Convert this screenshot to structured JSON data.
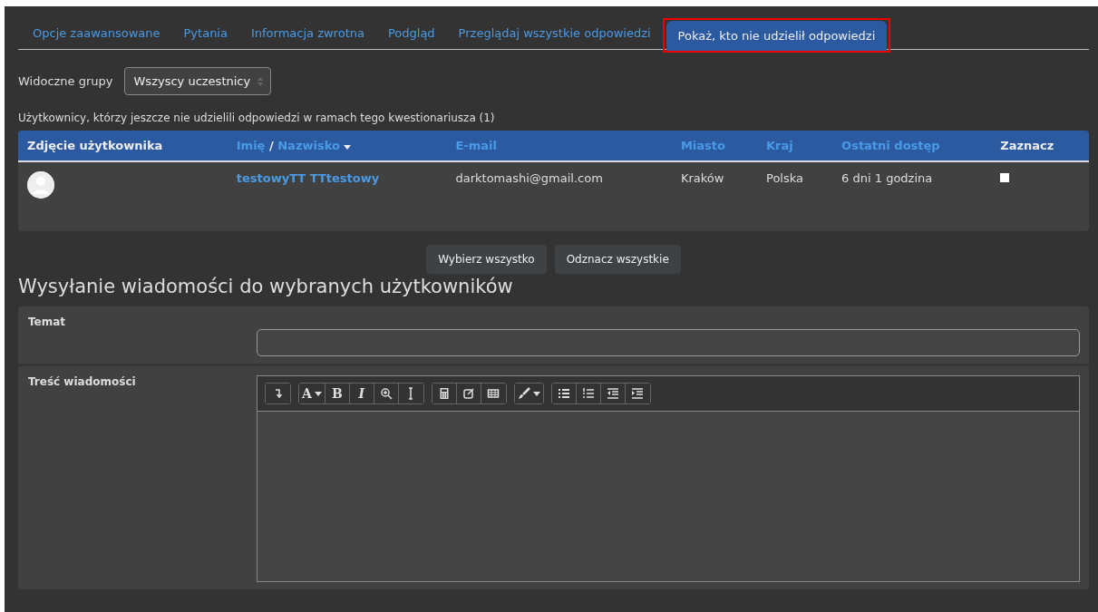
{
  "tabs": [
    {
      "label": "Opcje zaawansowane",
      "selected": false
    },
    {
      "label": "Pytania",
      "selected": false
    },
    {
      "label": "Informacja zwrotna",
      "selected": false
    },
    {
      "label": "Podgląd",
      "selected": false
    },
    {
      "label": "Przeglądaj wszystkie odpowiedzi",
      "selected": false
    },
    {
      "label": "Pokaż, kto nie udzielił odpowiedzi",
      "selected": true,
      "highlighted": true
    }
  ],
  "group_filter": {
    "label": "Widoczne grupy",
    "value": "Wszyscy uczestnicy"
  },
  "caption": "Użytkownicy, którzy jeszcze nie udzielili odpowiedzi w ramach tego kwestionariusza (1)",
  "table": {
    "columns": [
      {
        "parts": [
          {
            "label": "Zdjęcie użytkownika",
            "link": false,
            "sorted": false
          }
        ]
      },
      {
        "parts": [
          {
            "label": "Imię",
            "link": true,
            "sorted": false
          },
          {
            "label": "Nazwisko",
            "link": true,
            "sorted": true
          }
        ],
        "separator": "/"
      },
      {
        "parts": [
          {
            "label": "E-mail",
            "link": true,
            "sorted": false
          }
        ]
      },
      {
        "parts": [
          {
            "label": "Miasto",
            "link": true,
            "sorted": false
          }
        ]
      },
      {
        "parts": [
          {
            "label": "Kraj",
            "link": true,
            "sorted": false
          }
        ]
      },
      {
        "parts": [
          {
            "label": "Ostatni dostęp",
            "link": true,
            "sorted": false
          }
        ]
      },
      {
        "parts": [
          {
            "label": "Zaznacz",
            "link": false,
            "sorted": false
          }
        ]
      }
    ],
    "rows": [
      {
        "name": "testowyTT TTtestowy",
        "email": "darktomashi@gmail.com",
        "city": "Kraków",
        "country": "Polska",
        "last_access": "6 dni 1 godzina",
        "checked": false
      }
    ]
  },
  "table_buttons": [
    "Wybierz wszystko",
    "Odznacz wszystkie"
  ],
  "message_form": {
    "heading": "Wysyłanie wiadomości do wybranych użytkowników",
    "subject_label": "Temat",
    "body_label": "Treść wiadomości",
    "toolbar": [
      [
        {
          "kind": "collapse"
        }
      ],
      [
        {
          "kind": "font-color",
          "label": "A"
        },
        {
          "kind": "bold",
          "label": "B"
        },
        {
          "kind": "italic",
          "label": "I"
        },
        {
          "kind": "zoom"
        },
        {
          "kind": "text-cursor"
        }
      ],
      [
        {
          "kind": "calculator"
        },
        {
          "kind": "edit"
        },
        {
          "kind": "table"
        }
      ],
      [
        {
          "kind": "brush"
        }
      ],
      [
        {
          "kind": "bullet-list"
        },
        {
          "kind": "numbered-list"
        },
        {
          "kind": "outdent"
        },
        {
          "kind": "indent"
        }
      ]
    ]
  }
}
